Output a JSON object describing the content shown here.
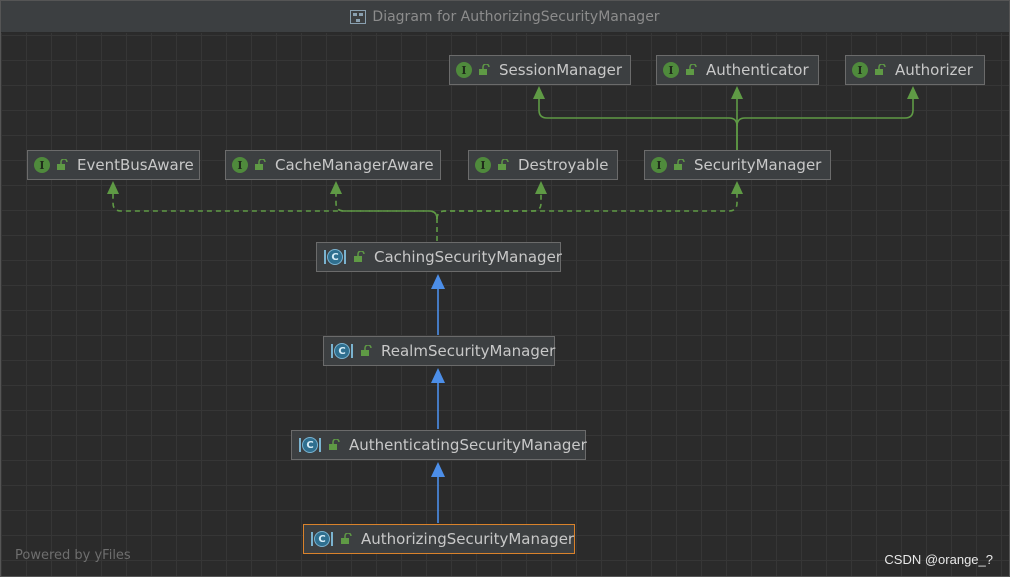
{
  "window": {
    "title": "Diagram for AuthorizingSecurityManager"
  },
  "nodes": {
    "session_manager": {
      "label": "SessionManager",
      "kind": "interface"
    },
    "authenticator": {
      "label": "Authenticator",
      "kind": "interface"
    },
    "authorizer": {
      "label": "Authorizer",
      "kind": "interface"
    },
    "event_bus_aware": {
      "label": "EventBusAware",
      "kind": "interface"
    },
    "cache_manager_aware": {
      "label": "CacheManagerAware",
      "kind": "interface"
    },
    "destroyable": {
      "label": "Destroyable",
      "kind": "interface"
    },
    "security_manager": {
      "label": "SecurityManager",
      "kind": "interface"
    },
    "caching_security_manager": {
      "label": "CachingSecurityManager",
      "kind": "abstract-class"
    },
    "realm_security_manager": {
      "label": "RealmSecurityManager",
      "kind": "abstract-class"
    },
    "authenticating_security_manager": {
      "label": "AuthenticatingSecurityManager",
      "kind": "abstract-class"
    },
    "authorizing_security_manager": {
      "label": "AuthorizingSecurityManager",
      "kind": "abstract-class",
      "selected": true
    }
  },
  "badges": {
    "interface": "I",
    "class": "C"
  },
  "edges": [
    {
      "from": "SecurityManager",
      "to": "SessionManager",
      "type": "extends"
    },
    {
      "from": "SecurityManager",
      "to": "Authenticator",
      "type": "extends"
    },
    {
      "from": "SecurityManager",
      "to": "Authorizer",
      "type": "extends"
    },
    {
      "from": "CachingSecurityManager",
      "to": "EventBusAware",
      "type": "implements"
    },
    {
      "from": "CachingSecurityManager",
      "to": "CacheManagerAware",
      "type": "implements"
    },
    {
      "from": "CachingSecurityManager",
      "to": "Destroyable",
      "type": "implements"
    },
    {
      "from": "CachingSecurityManager",
      "to": "SecurityManager",
      "type": "implements"
    },
    {
      "from": "RealmSecurityManager",
      "to": "CachingSecurityManager",
      "type": "extends"
    },
    {
      "from": "AuthenticatingSecurityManager",
      "to": "RealmSecurityManager",
      "type": "extends"
    },
    {
      "from": "AuthorizingSecurityManager",
      "to": "AuthenticatingSecurityManager",
      "type": "extends"
    }
  ],
  "colors": {
    "interface_edge": "#5f9a45",
    "class_edge": "#4c8ee8",
    "selected_border": "#d9822b"
  },
  "footer": {
    "powered_by": "Powered by yFiles"
  },
  "watermark": "CSDN @orange_?"
}
